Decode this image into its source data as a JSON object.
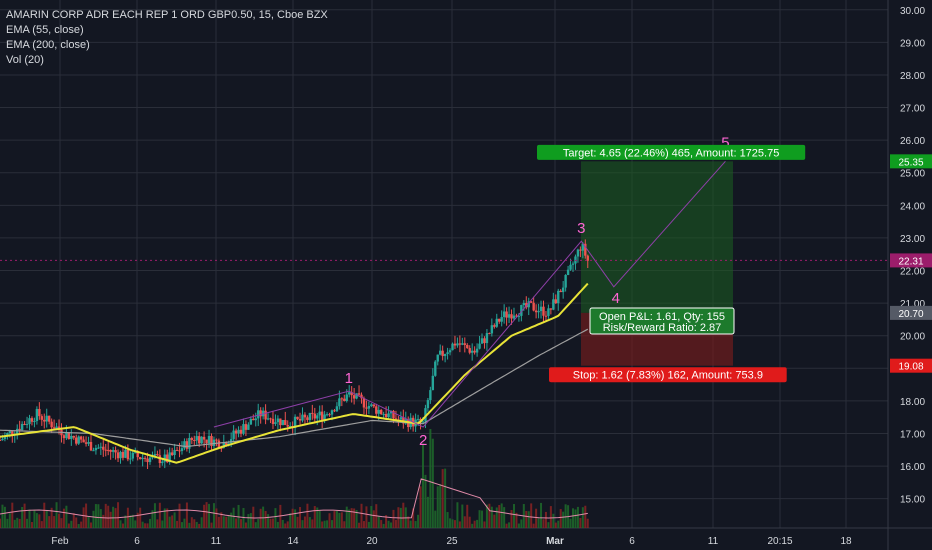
{
  "header": {
    "symbol_title": "AMARIN CORP ADR EACH REP 1 ORD GBP0.50, 15, Cboe BZX",
    "indicators": [
      "EMA (55, close)",
      "EMA (200, close)",
      "Vol (20)"
    ]
  },
  "colors": {
    "background": "#131722",
    "grid": "#2a2e39",
    "axis_text": "#d6d9de",
    "candle_up": "#26a69a",
    "candle_down": "#ef5350",
    "ema55": "#e8e337",
    "ema200": "#9e9e9e",
    "wave_line": "#8e3fa8",
    "wave_label": "#ff66d4",
    "target_zone": "#1b5e20",
    "stop_zone": "#7f1d1d",
    "target_badge": "#0f9d1f",
    "stop_badge": "#e01b1b",
    "price_badge": "#9c1d6b"
  },
  "chart_data": {
    "type": "candlestick",
    "title": "AMARIN CORP ADR EACH REP 1 ORD GBP0.50, 15, Cboe BZX",
    "y_axis": {
      "ticks": [
        "15.00",
        "16.00",
        "17.00",
        "18.00",
        "19.00",
        "20.00",
        "21.00",
        "22.00",
        "23.00",
        "24.00",
        "25.00",
        "26.00",
        "27.00",
        "28.00",
        "29.00",
        "30.00"
      ],
      "ylim": [
        14.1,
        30.3
      ]
    },
    "x_axis": {
      "ticks": [
        "Feb",
        "6",
        "11",
        "14",
        "20",
        "25",
        "Mar",
        "6",
        "11",
        "20:15",
        "18"
      ],
      "tick_positions_index": [
        0,
        1,
        2,
        3,
        4,
        5,
        6,
        7,
        8,
        9,
        10
      ]
    },
    "price_markers": [
      {
        "label": "25.35",
        "value": 25.35,
        "kind": "target"
      },
      {
        "label": "22.31",
        "value": 22.31,
        "kind": "last"
      },
      {
        "label": "20.70",
        "value": 20.7,
        "kind": "entry"
      },
      {
        "label": "19.08",
        "value": 19.08,
        "kind": "stop"
      }
    ],
    "wave_points": [
      {
        "label": "1",
        "t": 0.375,
        "price": 18.3
      },
      {
        "label": "2",
        "t": 0.455,
        "price": 17.2
      },
      {
        "label": "3",
        "t": 0.625,
        "price": 22.9
      },
      {
        "label": "4",
        "t": 0.66,
        "price": 21.5
      },
      {
        "label": "5",
        "t": 0.78,
        "price": 25.35
      }
    ],
    "price_path_key": [
      {
        "t": 0.0,
        "price": 16.8
      },
      {
        "t": 0.04,
        "price": 17.6
      },
      {
        "t": 0.07,
        "price": 17.0
      },
      {
        "t": 0.1,
        "price": 16.6
      },
      {
        "t": 0.14,
        "price": 16.3
      },
      {
        "t": 0.18,
        "price": 16.2
      },
      {
        "t": 0.21,
        "price": 16.9
      },
      {
        "t": 0.24,
        "price": 16.7
      },
      {
        "t": 0.28,
        "price": 17.6
      },
      {
        "t": 0.31,
        "price": 17.3
      },
      {
        "t": 0.35,
        "price": 17.6
      },
      {
        "t": 0.375,
        "price": 18.2
      },
      {
        "t": 0.4,
        "price": 17.8
      },
      {
        "t": 0.43,
        "price": 17.4
      },
      {
        "t": 0.455,
        "price": 17.3
      },
      {
        "t": 0.47,
        "price": 19.3
      },
      {
        "t": 0.49,
        "price": 19.8
      },
      {
        "t": 0.51,
        "price": 19.5
      },
      {
        "t": 0.54,
        "price": 20.6
      },
      {
        "t": 0.57,
        "price": 20.9
      },
      {
        "t": 0.59,
        "price": 20.7
      },
      {
        "t": 0.61,
        "price": 21.8
      },
      {
        "t": 0.625,
        "price": 22.8
      },
      {
        "t": 0.632,
        "price": 22.3
      }
    ],
    "ema55_key": [
      {
        "t": 0.0,
        "price": 16.9
      },
      {
        "t": 0.08,
        "price": 17.2
      },
      {
        "t": 0.14,
        "price": 16.5
      },
      {
        "t": 0.19,
        "price": 16.1
      },
      {
        "t": 0.24,
        "price": 16.6
      },
      {
        "t": 0.3,
        "price": 17.1
      },
      {
        "t": 0.38,
        "price": 17.6
      },
      {
        "t": 0.45,
        "price": 17.3
      },
      {
        "t": 0.5,
        "price": 18.8
      },
      {
        "t": 0.55,
        "price": 20.0
      },
      {
        "t": 0.6,
        "price": 20.6
      },
      {
        "t": 0.632,
        "price": 21.6
      }
    ],
    "ema200_key": [
      {
        "t": 0.0,
        "price": 17.1
      },
      {
        "t": 0.1,
        "price": 17.0
      },
      {
        "t": 0.2,
        "price": 16.6
      },
      {
        "t": 0.3,
        "price": 16.9
      },
      {
        "t": 0.4,
        "price": 17.4
      },
      {
        "t": 0.455,
        "price": 17.3
      },
      {
        "t": 0.52,
        "price": 18.4
      },
      {
        "t": 0.58,
        "price": 19.4
      },
      {
        "t": 0.632,
        "price": 20.2
      }
    ]
  },
  "position_tool": {
    "target_label": "Target: 4.65 (22.46%) 465, Amount: 1725.75",
    "pnl_line1": "Open P&L: 1.61, Qty: 155",
    "pnl_line2": "Risk/Reward Ratio: 2.87",
    "stop_label": "Stop: 1.62 (7.83%) 162, Amount: 753.9",
    "entry_price": 20.7,
    "target_price": 25.35,
    "stop_price": 19.08
  }
}
